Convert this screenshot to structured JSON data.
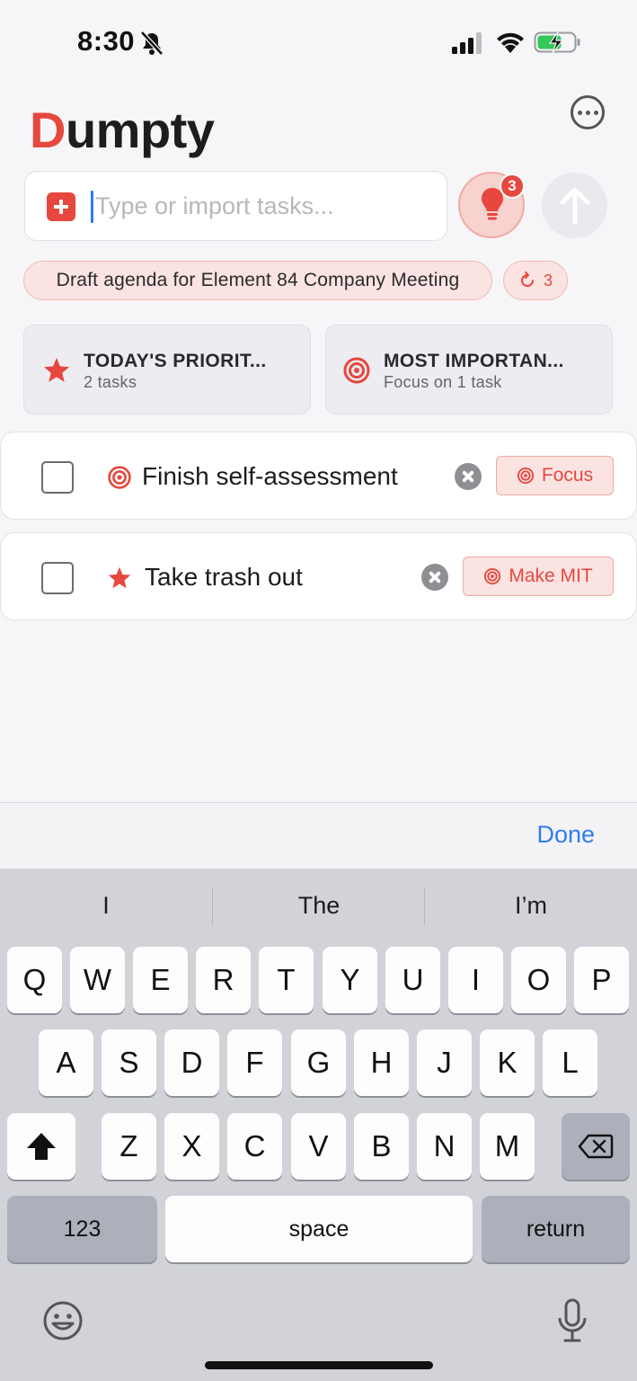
{
  "status_bar": {
    "time": "8:30"
  },
  "header": {
    "title_accent": "D",
    "title_rest": "umpty"
  },
  "input": {
    "placeholder": "Type or import tasks...",
    "value": ""
  },
  "ideas": {
    "badge_count": "3"
  },
  "suggestion": {
    "text": "Draft agenda for Element 84 Company Meeting"
  },
  "refresh": {
    "count": "3"
  },
  "cards": [
    {
      "title": "TODAY'S PRIORIT...",
      "subtitle": "2 tasks",
      "icon": "star-icon"
    },
    {
      "title": "MOST IMPORTAN...",
      "subtitle": "Focus on 1 task",
      "icon": "target-icon"
    }
  ],
  "tasks": [
    {
      "text": "Finish self-assessment",
      "icon": "target-icon",
      "checked": false,
      "action": "Focus"
    },
    {
      "text": "Take trash out",
      "icon": "star-icon",
      "checked": false,
      "action": "Make MIT"
    }
  ],
  "accessory": {
    "done_label": "Done"
  },
  "keyboard": {
    "predictions": [
      "I",
      "The",
      "I’m"
    ],
    "row1": [
      "Q",
      "W",
      "E",
      "R",
      "T",
      "Y",
      "U",
      "I",
      "O",
      "P"
    ],
    "row2": [
      "A",
      "S",
      "D",
      "F",
      "G",
      "H",
      "J",
      "K",
      "L"
    ],
    "row3": [
      "Z",
      "X",
      "C",
      "V",
      "B",
      "N",
      "M"
    ],
    "numbers_label": "123",
    "space_label": "space",
    "return_label": "return"
  },
  "colors": {
    "accent": "#e6483f",
    "link": "#2f7bf5",
    "chip_bg": "#fbe3e1"
  }
}
